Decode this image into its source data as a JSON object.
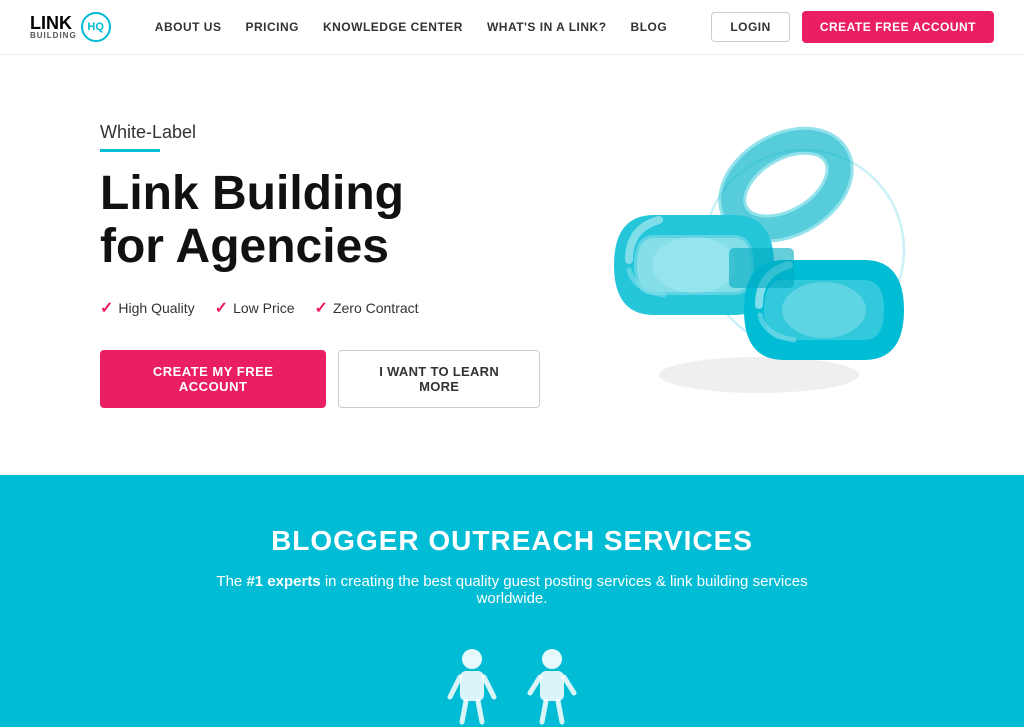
{
  "header": {
    "logo": {
      "link_text": "LINK",
      "building_text": "BUILDING",
      "hq_text": "HQ"
    },
    "nav": {
      "items": [
        {
          "label": "ABOUT US",
          "id": "about-us"
        },
        {
          "label": "PRICING",
          "id": "pricing"
        },
        {
          "label": "KNOWLEDGE CENTER",
          "id": "knowledge-center"
        },
        {
          "label": "WHAT'S IN A LINK?",
          "id": "whats-in-a-link"
        },
        {
          "label": "BLOG",
          "id": "blog"
        }
      ]
    },
    "login_label": "LOGIN",
    "create_account_label": "CREATE FREE ACCOUNT"
  },
  "hero": {
    "subtitle": "White-Label",
    "title_line1": "Link Building",
    "title_line2": "for Agencies",
    "features": [
      {
        "label": "High Quality",
        "icon": "✓"
      },
      {
        "label": "Low Price",
        "icon": "✓"
      },
      {
        "label": "Zero Contract",
        "icon": "✓"
      }
    ],
    "btn_primary": "CREATE MY FREE ACCOUNT",
    "btn_secondary": "I WANT TO LEARN MORE"
  },
  "bottom": {
    "title": "BLOGGER OUTREACH SERVICES",
    "description_pre": "The ",
    "description_bold": "#1 experts",
    "description_post": " in creating the best quality guest posting services & link building services worldwide."
  },
  "colors": {
    "accent_pink": "#e91e63",
    "accent_teal": "#00bcd4",
    "text_dark": "#111",
    "text_mid": "#333"
  }
}
